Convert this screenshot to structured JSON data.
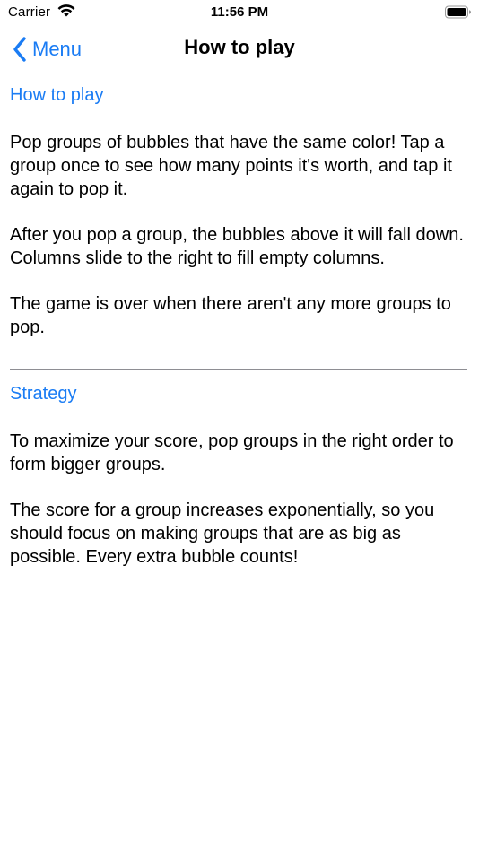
{
  "status_bar": {
    "carrier": "Carrier",
    "time": "11:56 PM",
    "icons": [
      "wifi-icon",
      "battery-icon"
    ]
  },
  "nav": {
    "back_label": "Menu",
    "back_icon": "chevron-left-icon",
    "title": "How to play"
  },
  "colors": {
    "accent": "#1a7cf4",
    "text": "#000000",
    "divider": "#8e8e93"
  },
  "sections": [
    {
      "heading": "How to play",
      "paragraphs": [
        "Pop groups of bubbles that have the same color! Tap a group once to see how many points it's worth, and tap it again to pop it.",
        "After you pop a group, the bubbles above it will fall down. Columns slide to the right to fill empty columns.",
        "The game is over when there aren't any more groups to pop."
      ]
    },
    {
      "heading": "Strategy",
      "paragraphs": [
        "To maximize your score, pop groups in the right order to form bigger groups.",
        "The score for a group increases exponentially, so you should focus on making groups that are as big as possible. Every extra bubble counts!"
      ]
    }
  ]
}
